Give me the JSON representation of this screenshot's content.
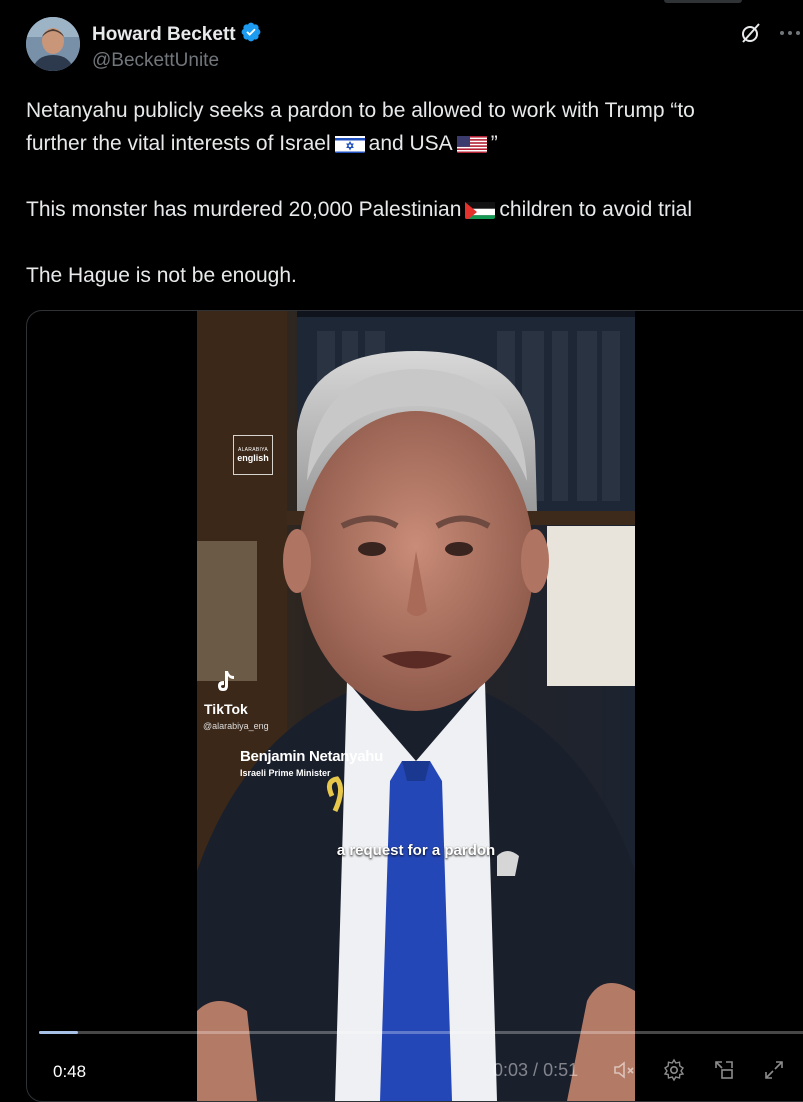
{
  "author": {
    "display_name": "Howard Beckett",
    "handle": "@BeckettUnite",
    "verified_icon": "verified-badge-icon"
  },
  "header_icons": [
    "grok-icon",
    "more-icon"
  ],
  "tweet": {
    "line1": "Netanyahu publicly seeks a pardon to be allowed to work with Trump “to",
    "line2a": "further the vital interests of Israel",
    "line2b": "and USA",
    "line2c": "”",
    "line3a": "This monster has murdered 20,000 Palestinian",
    "line3b": "children to avoid trial",
    "line4": "The Hague is not be enough."
  },
  "video": {
    "watermark_line1": "ALARABIYA",
    "watermark_line2": "english",
    "tiktok_label": "TikTok",
    "tiktok_handle": "@alarabiya_eng",
    "speaker_name": "Benjamin Netanyahu",
    "speaker_title": "Israeli Prime Minister",
    "caption": "a request for a pardon",
    "remaining_time": "0:48",
    "current_time": "0:03",
    "separator": " / ",
    "total_time": "0:51",
    "progress": 0.05
  },
  "colors": {
    "background": "#000000",
    "text": "#e7e9ea",
    "muted": "#71767b",
    "verified": "#1d9bf0"
  }
}
